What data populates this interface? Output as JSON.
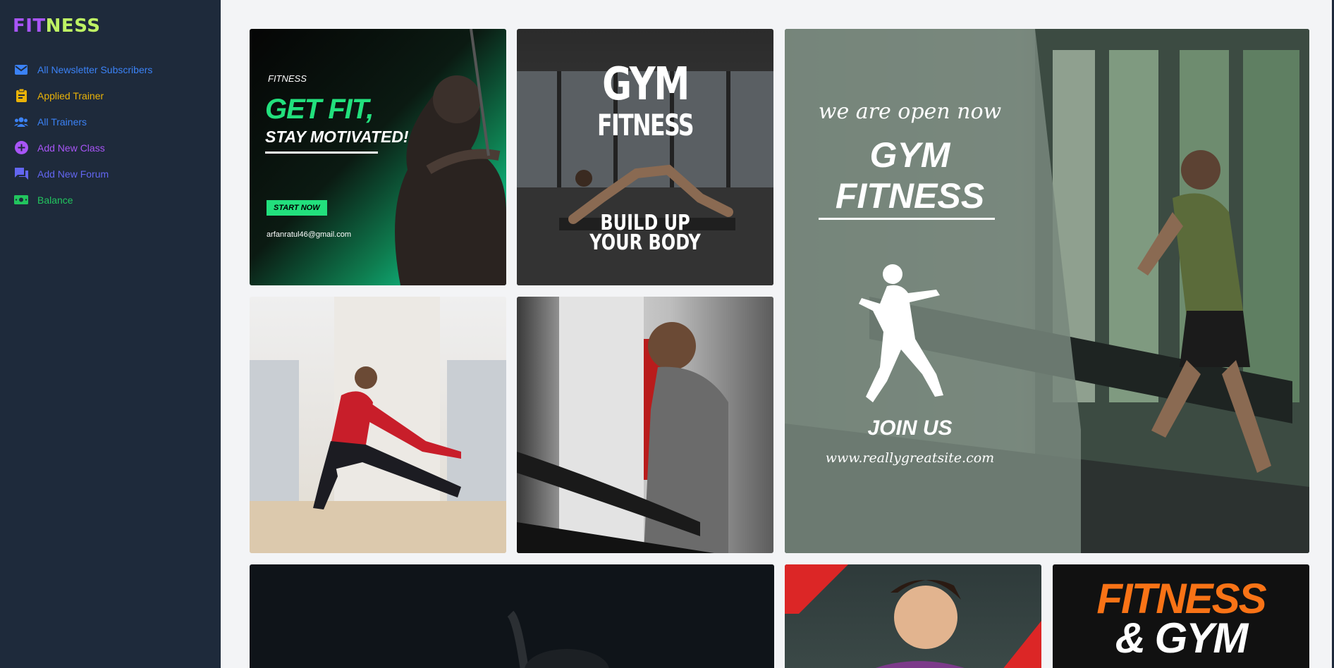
{
  "brand": {
    "part1": "FIT",
    "part2": "NESS"
  },
  "sidebar": {
    "items": [
      {
        "label": "All Newsletter Subscribers",
        "icon": "mail-icon",
        "color": "#3b82f6"
      },
      {
        "label": "Applied Trainer",
        "icon": "clipboard-icon",
        "color": "#eab308"
      },
      {
        "label": "All Trainers",
        "icon": "users-icon",
        "color": "#3b82f6"
      },
      {
        "label": "Add New Class",
        "icon": "plus-circle-icon",
        "color": "#a855f7"
      },
      {
        "label": "Add New Forum",
        "icon": "forum-icon",
        "color": "#6366f1"
      },
      {
        "label": "Balance",
        "icon": "money-icon",
        "color": "#22c55e"
      }
    ]
  },
  "gallery": {
    "tile1": {
      "brand": "FITNESS",
      "headline": "GET FIT,",
      "subheadline": "STAY MOTIVATED!",
      "button": "START NOW",
      "email": "arfanratul46@gmail.com"
    },
    "tile2": {
      "line1": "GYM",
      "line2": "FITNESS",
      "line3": "BUILD UP",
      "line4": "YOUR BODY"
    },
    "tile3": {
      "tagline": "we are open now",
      "line1": "GYM",
      "line2": "FITNESS",
      "cta": "JOIN US",
      "website": "www.reallygreatsite.com"
    },
    "tile8": {
      "line1": "FITNESS",
      "line2": "& GYM"
    }
  }
}
